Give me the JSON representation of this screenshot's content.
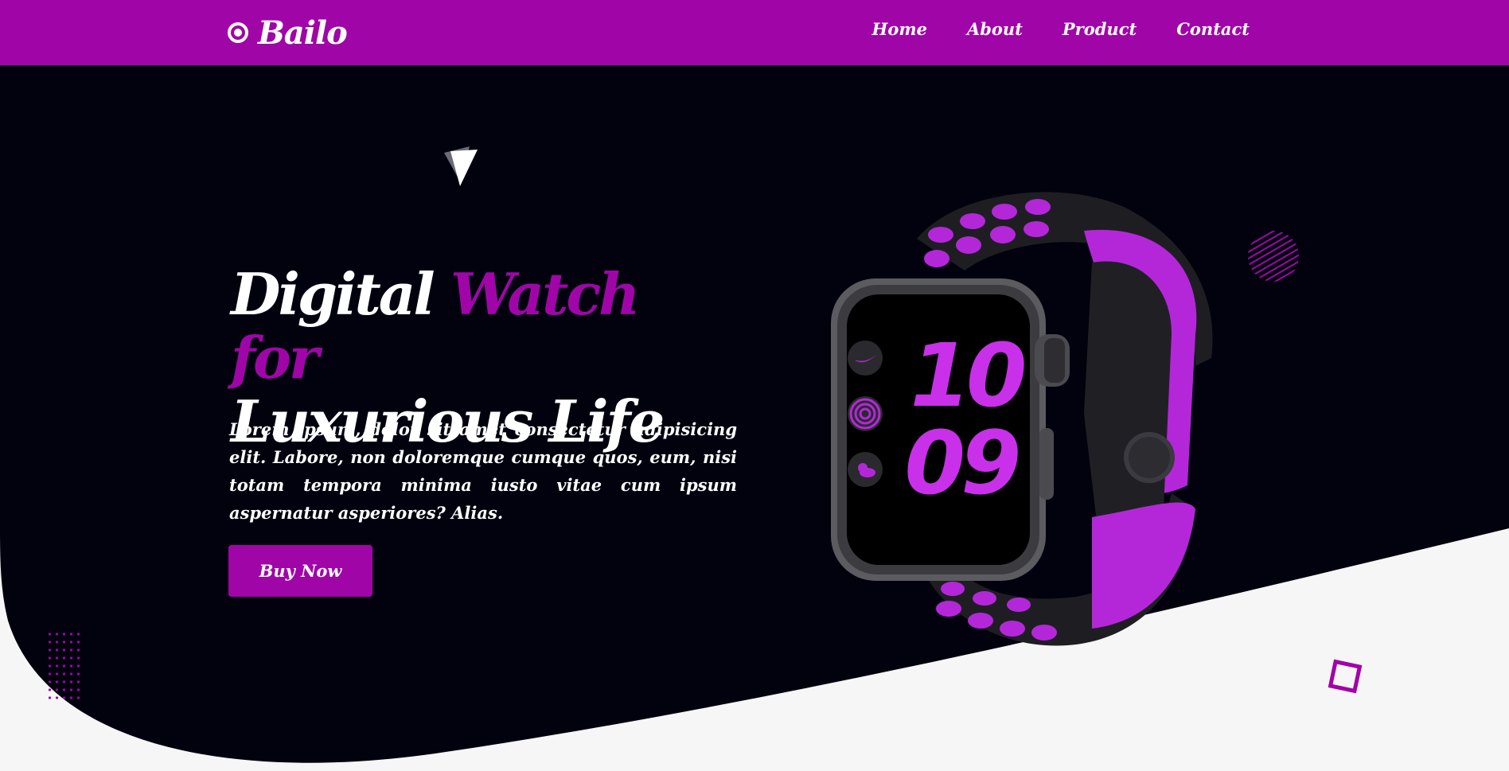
{
  "colors": {
    "brand": "#a005a8",
    "hero_bg": "#02020f",
    "page_bg": "#f6f6f6",
    "text": "#ffffff"
  },
  "navbar": {
    "logo_icon": "target-circle-icon",
    "brand": "Bailo",
    "links": [
      "Home",
      "About",
      "Product",
      "Contact"
    ]
  },
  "hero": {
    "headline_part1": "Digital ",
    "headline_accent": "Watch for",
    "headline_part2": "Luxurious Life",
    "description": "Lorem ipsum, dolor sit amet consectetur adipisicing elit. Labore, non doloremque cumque quos, eum, nisi totam tempora minima iusto vitae cum ipsum aspernatur asperiores? Alias.",
    "cta": "Buy Now"
  },
  "watch": {
    "hours": "10",
    "minutes": "09",
    "complications": [
      "nike-swoosh-icon",
      "activity-rings-icon",
      "weather-icon"
    ]
  }
}
